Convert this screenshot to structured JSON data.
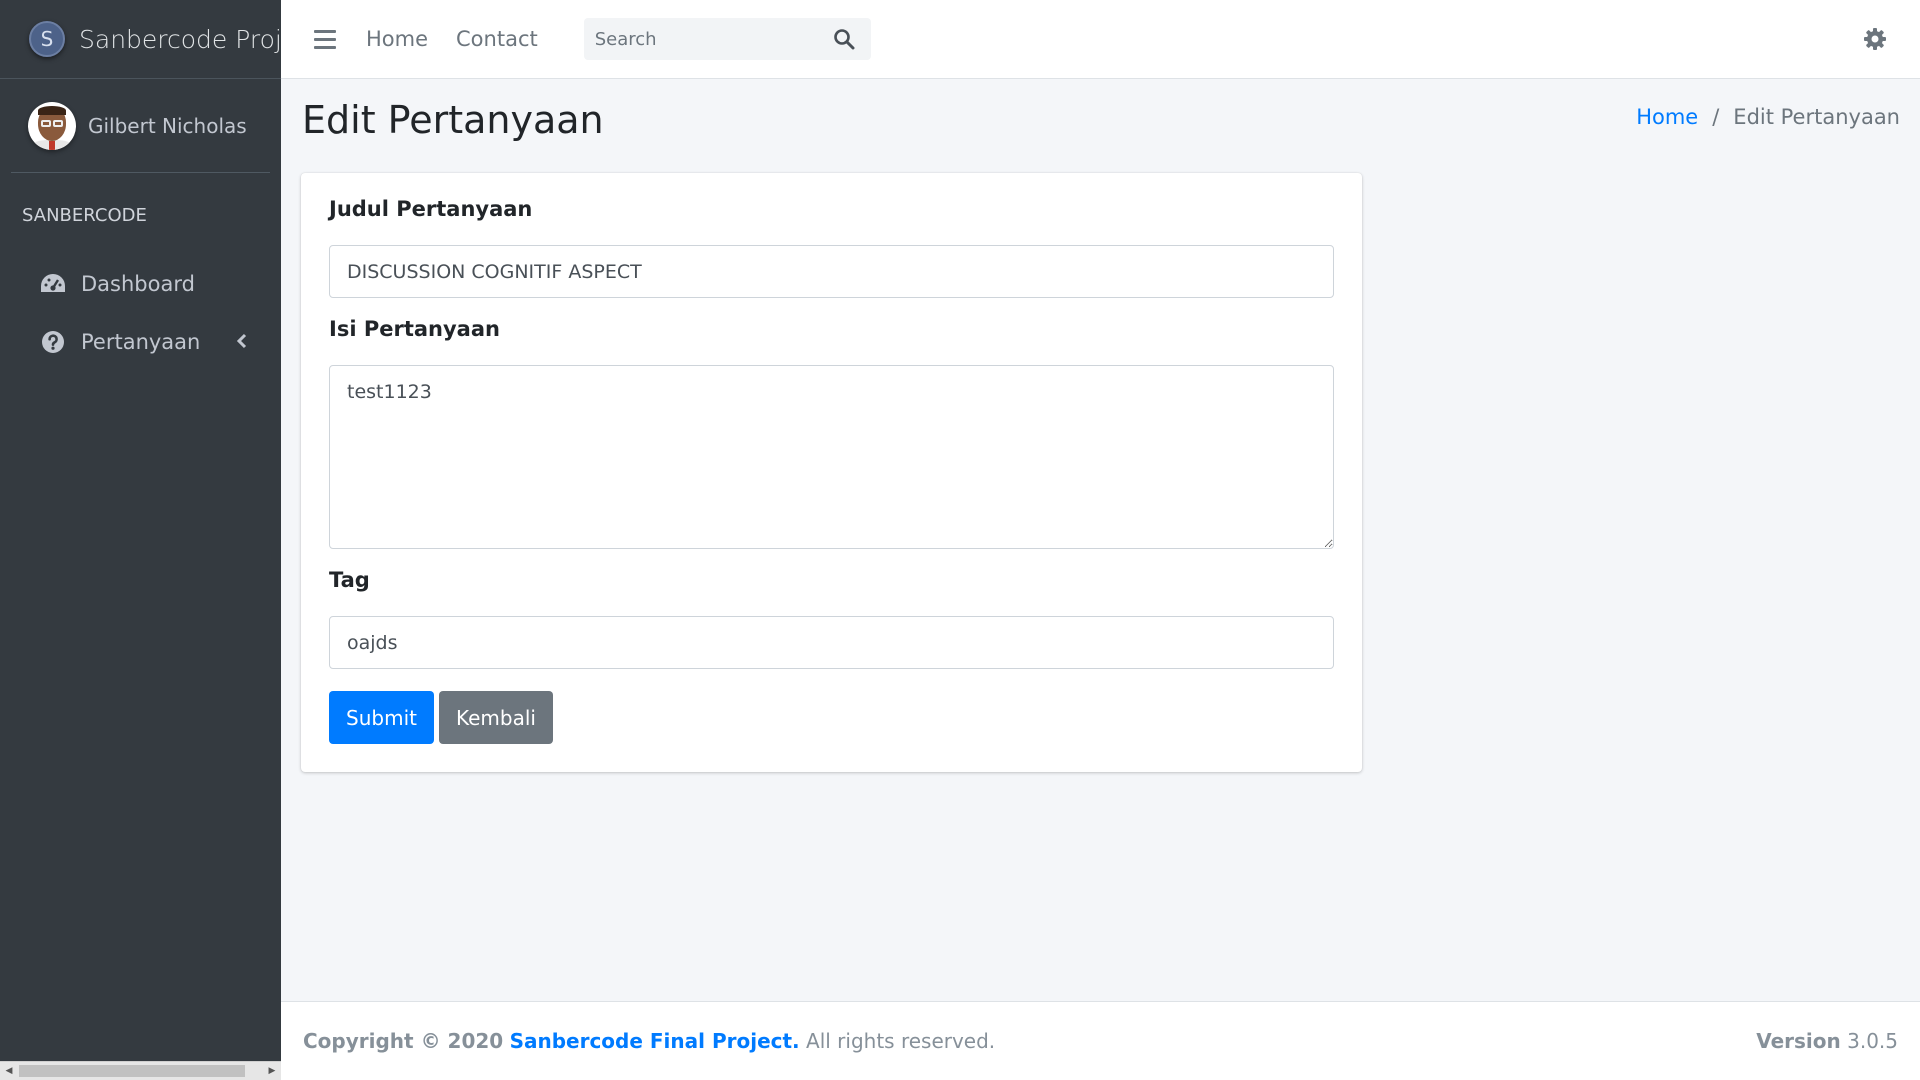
{
  "sidebar": {
    "brand_letter": "S",
    "brand_text": "Sanbercode Proje",
    "user_name": "Gilbert Nicholas",
    "section_header": "SANBERCODE",
    "items": [
      {
        "label": "Dashboard",
        "icon": "tachometer-icon"
      },
      {
        "label": "Pertanyaan",
        "icon": "question-circle-icon"
      }
    ]
  },
  "navbar": {
    "links": [
      "Home",
      "Contact"
    ],
    "search_placeholder": "Search"
  },
  "header": {
    "title": "Edit Pertanyaan",
    "breadcrumb": {
      "home": "Home",
      "current": "Edit Pertanyaan"
    }
  },
  "form": {
    "judul_label": "Judul Pertanyaan",
    "judul_value": "DISCUSSION COGNITIF ASPECT",
    "isi_label": "Isi Pertanyaan",
    "isi_value": "test1123",
    "tag_label": "Tag",
    "tag_value": "oajds",
    "submit_label": "Submit",
    "back_label": "Kembali"
  },
  "footer": {
    "copyright": "Copyright © 2020",
    "project_link": "Sanbercode Final Project.",
    "rights": "All rights reserved.",
    "version_label": "Version",
    "version_value": "3.0.5"
  },
  "colors": {
    "sidebar_bg": "#343a40",
    "primary": "#007bff",
    "secondary": "#6c757d",
    "content_bg": "#f4f6f9"
  }
}
